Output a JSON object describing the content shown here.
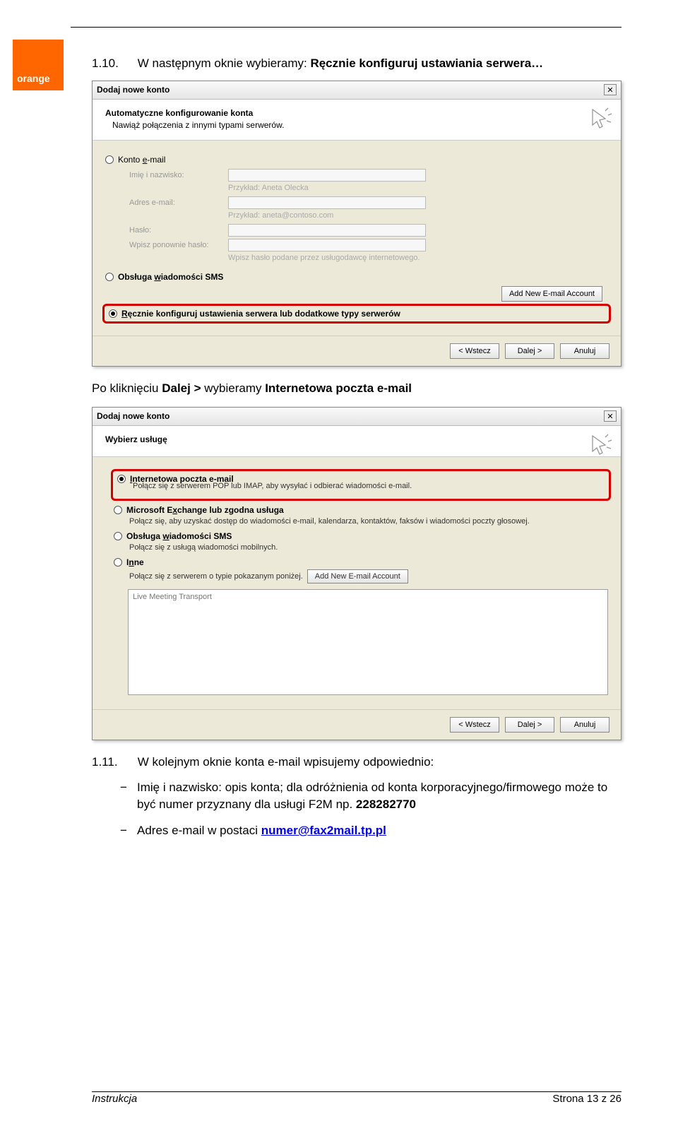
{
  "brand": {
    "logo": "orange"
  },
  "section1": {
    "num": "1.10.",
    "text_before": "W następnym oknie wybieramy: ",
    "text_bold": "Ręcznie konfiguruj ustawiania serwera…"
  },
  "dialog1": {
    "title": "Dodaj nowe konto",
    "header_title": "Automatyczne konfigurowanie konta",
    "header_sub": "Nawiąż połączenia z innymi typami serwerów.",
    "radio_email": "Konto e-mail",
    "form": {
      "name_label": "Imię i nazwisko:",
      "name_hint": "Przykład: Aneta Olecka",
      "email_label": "Adres e-mail:",
      "email_hint": "Przykład: aneta@contoso.com",
      "pw_label": "Hasło:",
      "pw2_label": "Wpisz ponownie hasło:",
      "pw_hint": "Wpisz hasło podane przez usługodawcę internetowego."
    },
    "radio_sms": "Obsługa wiadomości SMS",
    "addnew": "Add New E-mail Account",
    "radio_manual": "Ręcznie konfiguruj ustawienia serwera lub dodatkowe typy serwerów",
    "buttons": {
      "back": "< Wstecz",
      "next": "Dalej >",
      "cancel": "Anuluj"
    }
  },
  "between": {
    "before": "Po kliknięciu ",
    "bold1": "Dalej > ",
    "mid": "wybieramy ",
    "bold2": "Internetowa poczta e-mail"
  },
  "dialog2": {
    "title": "Dodaj nowe konto",
    "header_title": "Wybierz usługę",
    "opt_internet": {
      "label": "Internetowa poczta e-mail",
      "desc": "Połącz się z serwerem POP lub IMAP, aby wysyłać i odbierać wiadomości e-mail."
    },
    "opt_exchange": {
      "label": "Microsoft Exchange lub zgodna usługa",
      "desc": "Połącz się, aby uzyskać dostęp do wiadomości e-mail, kalendarza, kontaktów, faksów i wiadomości poczty głosowej."
    },
    "opt_sms": {
      "label": "Obsługa wiadomości SMS",
      "desc": "Połącz się z usługą wiadomości mobilnych."
    },
    "opt_other": {
      "label": "Inne",
      "desc": "Połącz się z serwerem o typie pokazanym poniżej."
    },
    "addnew": "Add New E-mail Account",
    "list_item": "Live Meeting Transport",
    "buttons": {
      "back": "< Wstecz",
      "next": "Dalej >",
      "cancel": "Anuluj"
    }
  },
  "section2": {
    "num": "1.11.",
    "text": "W kolejnym oknie konta e-mail wpisujemy odpowiednio:",
    "bullets": [
      {
        "text": "Imię i nazwisko: opis konta; dla odróżnienia od konta korporacyjnego/firmowego może to być numer przyznany dla usługi F2M np. ",
        "bold_tail": "228282770"
      },
      {
        "text": "Adres e-mail w postaci ",
        "link": "numer@fax2mail.tp.pl"
      }
    ]
  },
  "footer": {
    "left": "Instrukcja",
    "right": "Strona 13 z 26"
  }
}
